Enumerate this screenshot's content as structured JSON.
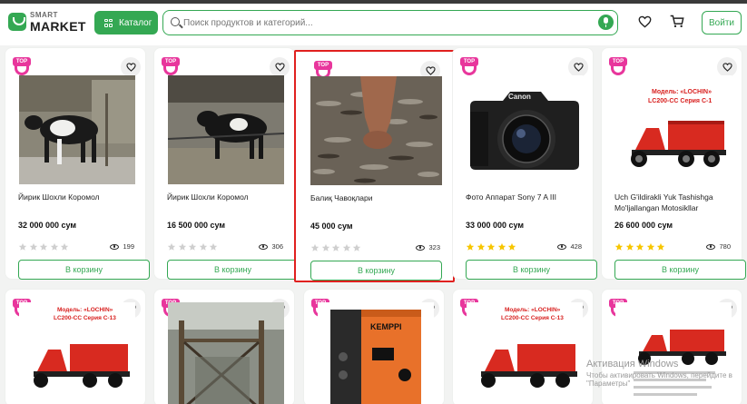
{
  "header": {
    "logo_top": "SMART",
    "logo_bottom": "MARKET",
    "catalog_label": "Каталог",
    "search_placeholder": "Поиск продуктов и категорий...",
    "login_label": "Войти"
  },
  "colors": {
    "brand": "#34a853",
    "badge": "#e8369c",
    "star_on": "#f7c600",
    "star_off": "#cfcfcf",
    "highlight": "#e0201f"
  },
  "badge_label": "TOP",
  "cart_label": "В корзину",
  "products": [
    {
      "title": "Йирик Шохли Коромол",
      "price": "32 000 000 сум",
      "rating": 0,
      "views": "199"
    },
    {
      "title": "Йирик Шохли Коромол",
      "price": "16 500 000 сум",
      "rating": 0,
      "views": "306"
    },
    {
      "title": "Балиқ Чавоқлари",
      "price": "45 000 сум",
      "rating": 0,
      "views": "323"
    },
    {
      "title": "Фото Аппарат Sony 7 A III",
      "price": "33 000 000 сум",
      "rating": 5,
      "views": "428"
    },
    {
      "title": "Uch G'ildirakli Yuk Tashishga Mo'ljallangan Motosikllar",
      "price": "26 600 000 сум",
      "rating": 5,
      "views": "780"
    }
  ],
  "trike_ad": {
    "model_line1": "Модель: «LOCHIN»",
    "model_line2": "LC200-CC Серия С-1",
    "model_line2_b": "LC200-CC Серия С-13"
  },
  "welder_brand": "KEMPPI",
  "camera_brand": "Canon",
  "watermark": {
    "line1": "Активация Windows",
    "line2": "Чтобы активировать Windows, перейдите в \"Параметры\""
  }
}
